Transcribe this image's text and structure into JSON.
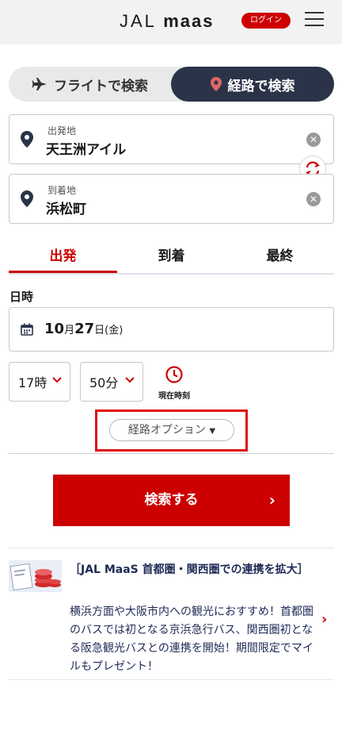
{
  "header": {
    "logo_jal": "JAL",
    "logo_maas": "maas",
    "login_label": "ログイン"
  },
  "mode": {
    "flight_label": "フライトで検索",
    "route_label": "経路で検索",
    "active": "route"
  },
  "origin": {
    "label": "出発地",
    "value": "天王洲アイル"
  },
  "destination": {
    "label": "到着地",
    "value": "浜松町"
  },
  "tabs": {
    "departure": "出発",
    "arrival": "到着",
    "last": "最終",
    "active": "departure"
  },
  "datetime": {
    "label": "日時",
    "month": "10",
    "month_unit": "月",
    "day": "27",
    "day_unit": "日",
    "weekday": "(金)",
    "hour": "17時",
    "minute": "50分",
    "now_label": "現在時刻"
  },
  "route_options_label": "経路オプション",
  "search_button_label": "検索する",
  "news": {
    "title": "［JAL MaaS 首都圏・関西圏での連携を拡大］",
    "body": "横浜方面や大阪市内への観光におすすめ！首都圏のバスでは初となる京浜急行バス、関西圏初となる阪急観光バスとの連携を開始！期間限定でマイルもプレゼント！"
  },
  "colors": {
    "brand_red": "#cc0000",
    "navy": "#2a3348",
    "news_text": "#1f2a56"
  }
}
